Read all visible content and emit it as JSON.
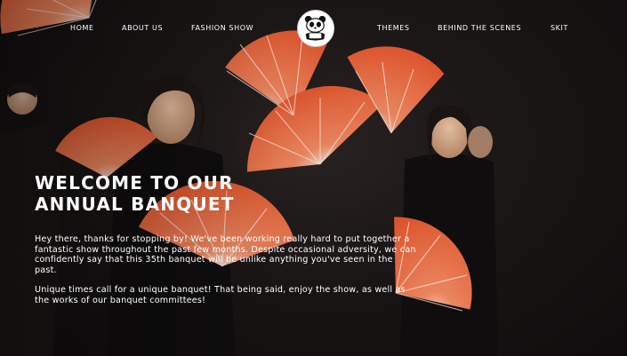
{
  "nav": {
    "items": [
      {
        "label": "HOME"
      },
      {
        "label": "ABOUT US"
      },
      {
        "label": "FASHION SHOW"
      },
      {
        "label": "THEMES"
      },
      {
        "label": "BEHIND THE SCENES"
      },
      {
        "label": "SKIT"
      }
    ]
  },
  "logo": {
    "icon": "panda-logo-icon"
  },
  "hero": {
    "title": "WELCOME TO OUR ANNUAL BANQUET",
    "paragraphs": [
      "Hey there, thanks for stopping by! We've been working really hard to put together a fantastic show throughout the past few months. Despite occasional adversity, we can confidently say that this 35th banquet will be unlike anything you've seen in the past.",
      "Unique times call for a unique banquet! That being said, enjoy the show, as well as the works of our banquet committees!"
    ]
  },
  "colors": {
    "background": "#141414",
    "fan": "#e8603c",
    "text": "#ffffff"
  }
}
